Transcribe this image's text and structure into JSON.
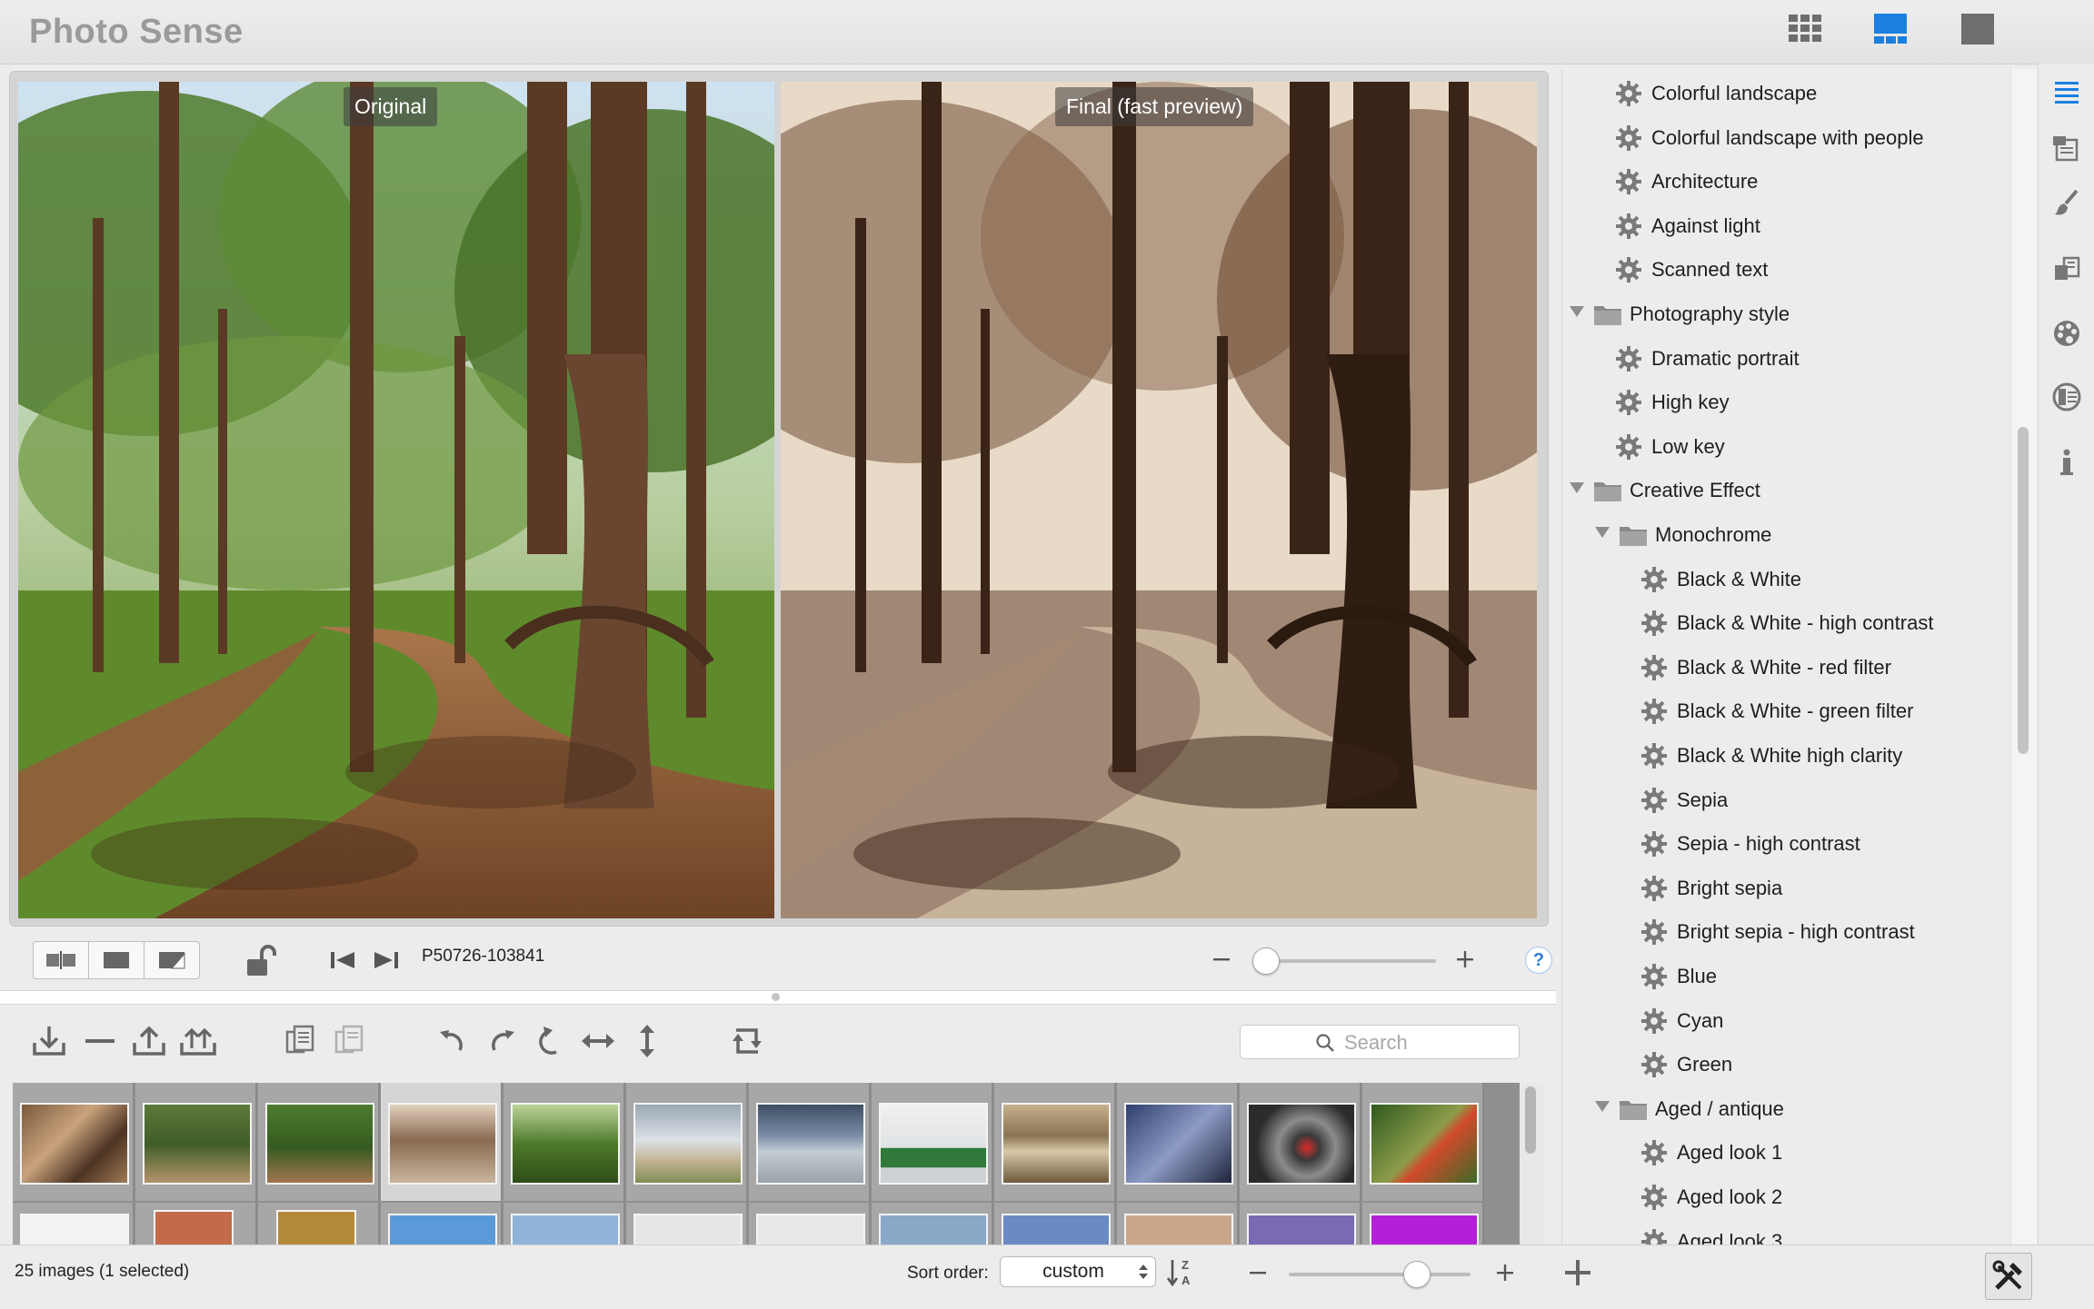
{
  "app": {
    "title": "Photo Sense"
  },
  "view_modes": [
    {
      "name": "grid-view",
      "icon": "grid-icon",
      "active": false
    },
    {
      "name": "split-view",
      "icon": "split-layout-icon",
      "active": true
    },
    {
      "name": "single-view",
      "icon": "single-image-icon",
      "active": false
    }
  ],
  "preview": {
    "left_label": "Original",
    "right_label": "Final (fast preview)",
    "filename": "P50726-103841",
    "zoom_level": 0.0,
    "help_label": "?"
  },
  "toolbar": {
    "search_placeholder": "Search",
    "icons": [
      "import-icon",
      "remove-icon",
      "export-icon",
      "export-all-icon",
      "copy-settings-icon",
      "paste-settings-icon",
      "rotate-left-icon",
      "rotate-right-icon",
      "rotate-free-icon",
      "flip-horizontal-icon",
      "flip-vertical-icon",
      "crop-icon"
    ]
  },
  "thumbnails": {
    "count_visible_row1": 12,
    "selected_index": 3
  },
  "status": {
    "image_count": "25 images (1 selected)",
    "sort_label": "Sort order:",
    "sort_value": "custom",
    "thumb_zoom": 0.7
  },
  "presets": [
    {
      "type": "preset",
      "level": 1,
      "label": "Colorful landscape"
    },
    {
      "type": "preset",
      "level": 1,
      "label": "Colorful landscape with people"
    },
    {
      "type": "preset",
      "level": 1,
      "label": "Architecture"
    },
    {
      "type": "preset",
      "level": 1,
      "label": "Against light"
    },
    {
      "type": "preset",
      "level": 1,
      "label": "Scanned text"
    },
    {
      "type": "folder",
      "level": 0,
      "label": "Photography style"
    },
    {
      "type": "preset",
      "level": 1,
      "label": "Dramatic portrait"
    },
    {
      "type": "preset",
      "level": 1,
      "label": "High key"
    },
    {
      "type": "preset",
      "level": 1,
      "label": "Low key"
    },
    {
      "type": "folder",
      "level": 0,
      "label": "Creative Effect"
    },
    {
      "type": "folder",
      "level": 1,
      "label": "Monochrome"
    },
    {
      "type": "preset",
      "level": 2,
      "label": "Black & White"
    },
    {
      "type": "preset",
      "level": 2,
      "label": "Black & White - high contrast"
    },
    {
      "type": "preset",
      "level": 2,
      "label": "Black & White - red filter"
    },
    {
      "type": "preset",
      "level": 2,
      "label": "Black & White - green filter"
    },
    {
      "type": "preset",
      "level": 2,
      "label": "Black & White high clarity"
    },
    {
      "type": "preset",
      "level": 2,
      "label": "Sepia"
    },
    {
      "type": "preset",
      "level": 2,
      "label": "Sepia - high contrast"
    },
    {
      "type": "preset",
      "level": 2,
      "label": "Bright sepia"
    },
    {
      "type": "preset",
      "level": 2,
      "label": "Bright sepia - high contrast"
    },
    {
      "type": "preset",
      "level": 2,
      "label": "Blue"
    },
    {
      "type": "preset",
      "level": 2,
      "label": "Cyan"
    },
    {
      "type": "preset",
      "level": 2,
      "label": "Green"
    },
    {
      "type": "folder",
      "level": 1,
      "label": "Aged / antique"
    },
    {
      "type": "preset",
      "level": 2,
      "label": "Aged look 1"
    },
    {
      "type": "preset",
      "level": 2,
      "label": "Aged look 2"
    },
    {
      "type": "preset",
      "level": 2,
      "label": "Aged look 3"
    }
  ],
  "side_icons": [
    "list-icon",
    "adjustments-icon",
    "brush-icon",
    "layers-icon",
    "palette-icon",
    "effects-icon",
    "info-icon"
  ],
  "colors": {
    "accent": "#1a7fe0",
    "sepia_dark": "#3a2418",
    "sepia_light": "#e8dac6"
  }
}
